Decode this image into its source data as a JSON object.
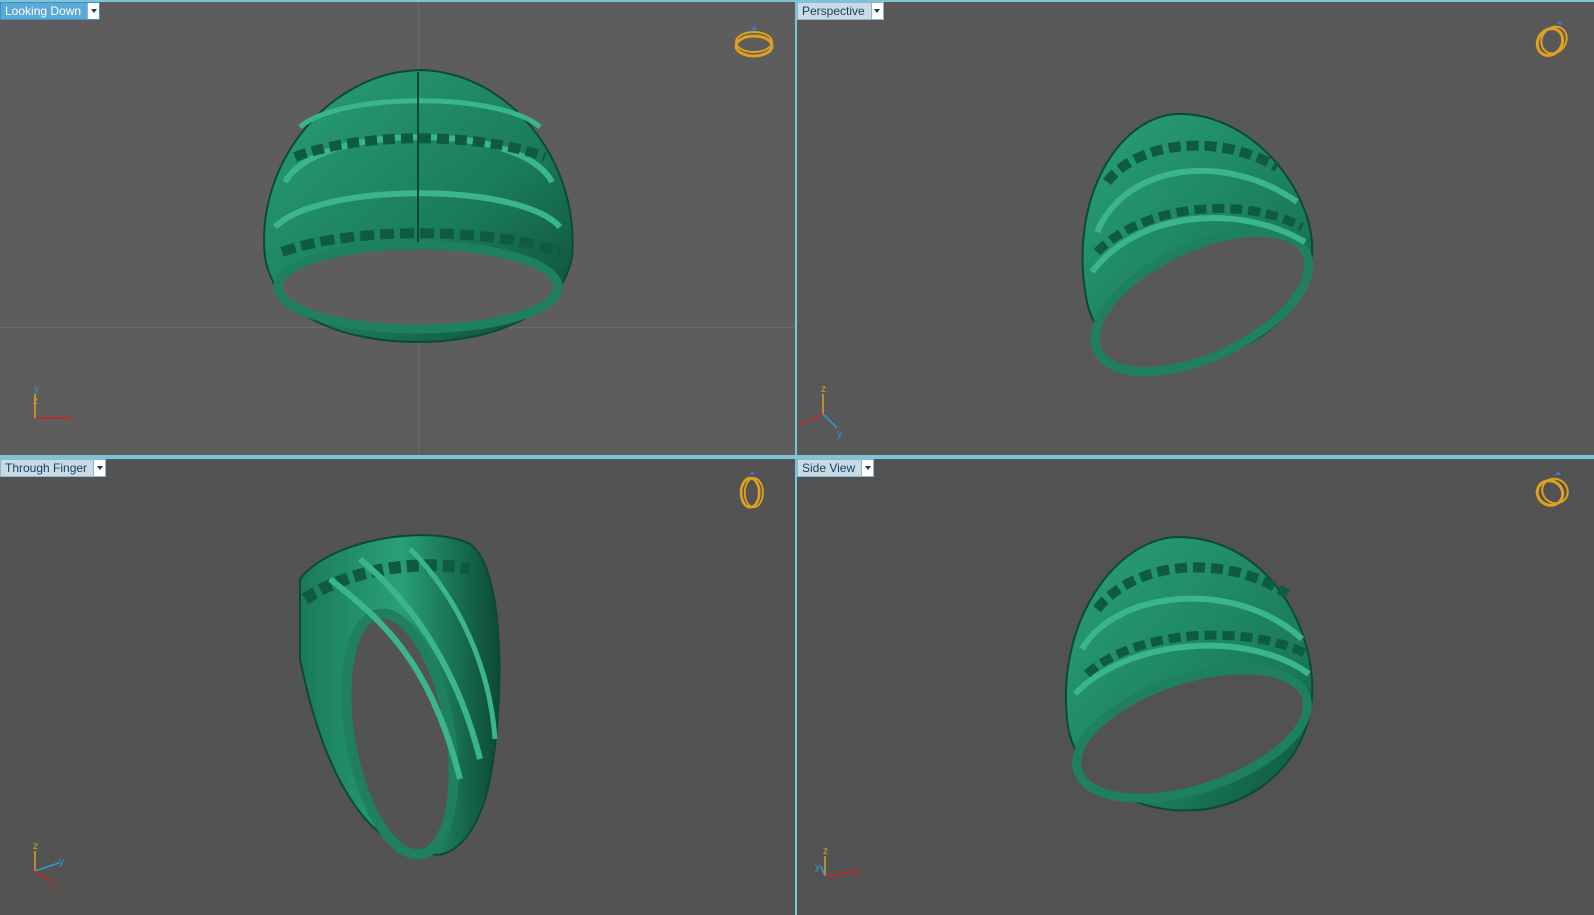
{
  "viewports": {
    "top_left": {
      "label": "Looking Down",
      "axes": [
        "y",
        "z",
        "x"
      ]
    },
    "top_right": {
      "label": "Perspective",
      "axes": [
        "z",
        "x",
        "y"
      ]
    },
    "bottom_left": {
      "label": "Through Finger",
      "axes": [
        "z",
        "y",
        "x"
      ]
    },
    "bottom_right": {
      "label": "Side View",
      "axes": [
        "z",
        "y",
        "x"
      ]
    }
  },
  "colors": {
    "ring_green": "#1f8a67",
    "ring_dark": "#0c4a36",
    "ring_light": "#3bb58a",
    "nav_icon_gold": "#e0a020",
    "axis_x": "#d42020",
    "axis_y": "#2aa0d0",
    "axis_z": "#e0a020"
  }
}
